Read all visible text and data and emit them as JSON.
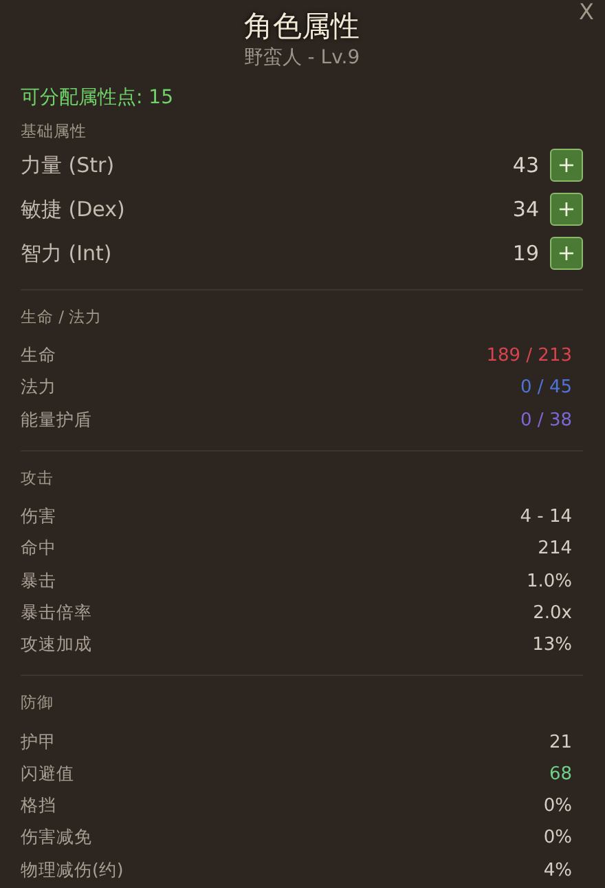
{
  "title": "角色属性",
  "close": "X",
  "subtitle": "野蛮人 - Lv.9",
  "points": "可分配属性点: 15",
  "base": {
    "heading": "基础属性",
    "stats": [
      {
        "name": "力量 (Str)",
        "value": "43",
        "add": "+"
      },
      {
        "name": "敏捷 (Dex)",
        "value": "34",
        "add": "+"
      },
      {
        "name": "智力 (Int)",
        "value": "19",
        "add": "+"
      }
    ]
  },
  "sections": [
    {
      "heading": "生命 / 法力",
      "rows": [
        {
          "name": "生命",
          "value": "189 / 213",
          "color": "#d8434f"
        },
        {
          "name": "法力",
          "value": "0 / 45",
          "color": "#4f73d8"
        },
        {
          "name": "能量护盾",
          "value": "0 / 38",
          "color": "#7a68d8"
        }
      ]
    },
    {
      "heading": "攻击",
      "rows": [
        {
          "name": "伤害",
          "value": "4 - 14",
          "color": "#d4cec4"
        },
        {
          "name": "命中",
          "value": "214",
          "color": "#d4cec4"
        },
        {
          "name": "暴击",
          "value": "1.0%",
          "color": "#d4cec4"
        },
        {
          "name": "暴击倍率",
          "value": "2.0x",
          "color": "#d4cec4"
        },
        {
          "name": "攻速加成",
          "value": "13%",
          "color": "#d4cec4"
        }
      ]
    },
    {
      "heading": "防御",
      "rows": [
        {
          "name": "护甲",
          "value": "21",
          "color": "#d4cec4"
        },
        {
          "name": "闪避值",
          "value": "68",
          "color": "#6fd08a"
        },
        {
          "name": "格挡",
          "value": "0%",
          "color": "#d4cec4"
        },
        {
          "name": "伤害减免",
          "value": "0%",
          "color": "#d4cec4"
        },
        {
          "name": "物理减伤(约)",
          "value": "4%",
          "color": "#d4cec4"
        }
      ]
    }
  ]
}
